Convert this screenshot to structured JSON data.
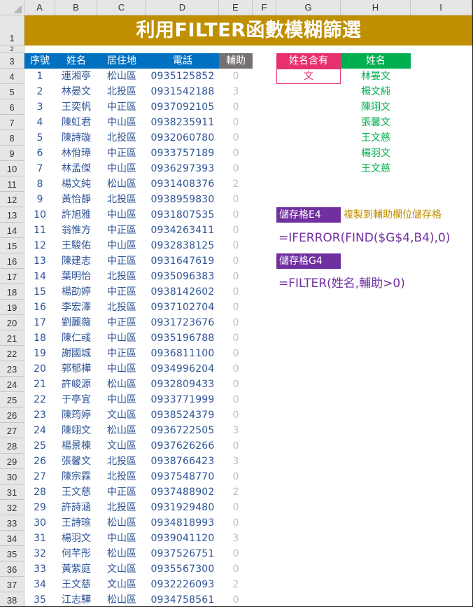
{
  "sheet": {
    "columns": [
      "A",
      "B",
      "C",
      "D",
      "E",
      "F",
      "G",
      "H",
      "I"
    ],
    "rows": [
      1,
      2,
      3,
      4,
      5,
      6,
      7,
      8,
      9,
      10,
      11,
      12,
      13,
      14,
      15,
      16,
      17,
      18,
      19,
      20,
      21,
      22,
      23,
      24,
      25,
      26,
      27,
      28,
      29,
      30,
      31,
      32,
      33,
      34,
      35,
      36,
      37,
      38
    ]
  },
  "title": "利用FILTER函數模糊篩選",
  "table": {
    "headers": [
      "序號",
      "姓名",
      "居住地",
      "電話",
      "輔助"
    ],
    "rows": [
      [
        "1",
        "連湘亭",
        "松山區",
        "0935125852",
        "0"
      ],
      [
        "2",
        "林晏文",
        "北投區",
        "0931542188",
        "3"
      ],
      [
        "3",
        "王奕帆",
        "中正區",
        "0937092105",
        "0"
      ],
      [
        "4",
        "陳虹君",
        "中山區",
        "0938235911",
        "0"
      ],
      [
        "5",
        "陳詩璇",
        "北投區",
        "0932060780",
        "0"
      ],
      [
        "6",
        "林佾璋",
        "中正區",
        "0933757189",
        "0"
      ],
      [
        "7",
        "林孟傑",
        "中山區",
        "0936297393",
        "0"
      ],
      [
        "8",
        "楊文純",
        "松山區",
        "0931408376",
        "2"
      ],
      [
        "9",
        "黃怡靜",
        "北投區",
        "0938959830",
        "0"
      ],
      [
        "10",
        "許旭雅",
        "中山區",
        "0931807535",
        "0"
      ],
      [
        "11",
        "翁惟方",
        "中正區",
        "0934263411",
        "0"
      ],
      [
        "12",
        "王駿佑",
        "中山區",
        "0932838125",
        "0"
      ],
      [
        "13",
        "陳建志",
        "中正區",
        "0931647619",
        "0"
      ],
      [
        "14",
        "葉明怡",
        "北投區",
        "0935096383",
        "0"
      ],
      [
        "15",
        "楊劭婷",
        "中正區",
        "0938142602",
        "0"
      ],
      [
        "16",
        "李宏澤",
        "北投區",
        "0937102704",
        "0"
      ],
      [
        "17",
        "劉麗薇",
        "中正區",
        "0931723676",
        "0"
      ],
      [
        "18",
        "陳仁彧",
        "中山區",
        "0935196788",
        "0"
      ],
      [
        "19",
        "謝國城",
        "中正區",
        "0936811100",
        "0"
      ],
      [
        "20",
        "郭郁樺",
        "中山區",
        "0934996204",
        "0"
      ],
      [
        "21",
        "許峻源",
        "松山區",
        "0932809433",
        "0"
      ],
      [
        "22",
        "于亭宜",
        "中山區",
        "0933771999",
        "0"
      ],
      [
        "23",
        "陳筠婷",
        "文山區",
        "0938524379",
        "0"
      ],
      [
        "24",
        "陳翊文",
        "松山區",
        "0936722505",
        "3"
      ],
      [
        "25",
        "楊景棟",
        "文山區",
        "0937626266",
        "0"
      ],
      [
        "26",
        "張馨文",
        "北投區",
        "0938766423",
        "3"
      ],
      [
        "27",
        "陳宗霖",
        "北投區",
        "0937548770",
        "0"
      ],
      [
        "28",
        "王文慈",
        "中正區",
        "0937488902",
        "2"
      ],
      [
        "29",
        "許詩涵",
        "北投區",
        "0931929480",
        "0"
      ],
      [
        "30",
        "王詩瑜",
        "松山區",
        "0934818993",
        "0"
      ],
      [
        "31",
        "楊羽文",
        "中山區",
        "0939041120",
        "3"
      ],
      [
        "32",
        "何芊彤",
        "松山區",
        "0937526751",
        "0"
      ],
      [
        "33",
        "黃紫庭",
        "文山區",
        "0935567300",
        "0"
      ],
      [
        "34",
        "王文慈",
        "文山區",
        "0932226093",
        "2"
      ],
      [
        "35",
        "江志驊",
        "松山區",
        "0934758561",
        "0"
      ]
    ]
  },
  "filter": {
    "criteria_header": "姓名含有",
    "criteria_value": "文",
    "result_header": "姓名",
    "results": [
      "林晏文",
      "楊文純",
      "陳翊文",
      "張馨文",
      "王文慈",
      "楊羽文",
      "王文慈"
    ]
  },
  "notes": {
    "e4_label": "儲存格E4",
    "e4_note": "複製到輔助欄位儲存格",
    "e4_formula": "=IFERROR(FIND($G$4,B4),0)",
    "g4_label": "儲存格G4",
    "g4_formula": "=FILTER(姓名,輔助>0)"
  },
  "colors": {
    "title_bg": "#bf8f00",
    "header_blue": "#0070c0",
    "aux_gray": "#767171",
    "criteria_pink": "#e8306e",
    "result_green": "#00b050",
    "label_purple": "#7030a0",
    "data_text": "#2f5597"
  }
}
